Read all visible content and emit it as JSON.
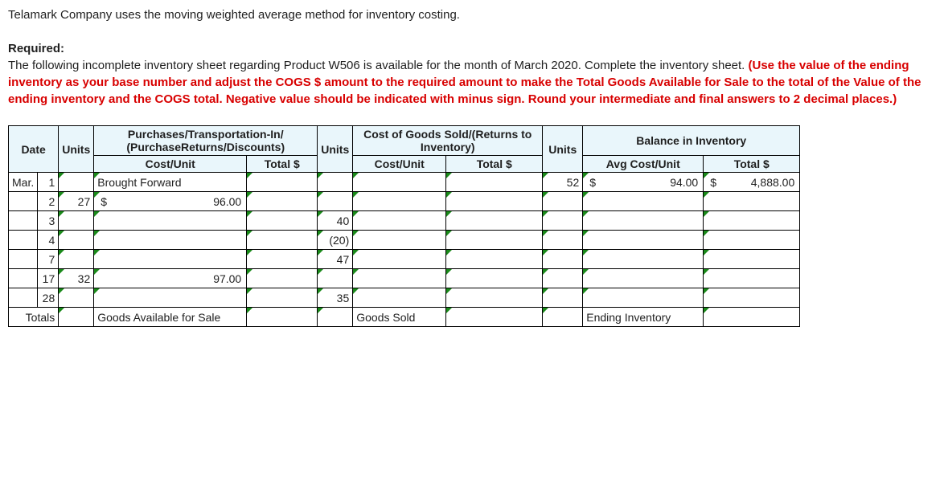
{
  "intro": {
    "line1": "Telamark Company uses the moving weighted average method for inventory costing.",
    "required_label": "Required:",
    "line2a": "The following incomplete inventory sheet regarding Product W506 is available for the month of March 2020. Complete the inventory sheet. ",
    "line2b": "(Use the value of the ending inventory as your base number and adjust the COGS $ amount to the required amount to make the Total Goods Available for Sale to the total of the Value of the ending inventory and the COGS total. Negative value should be indicated with minus sign. Round your intermediate and final answers to 2 decimal places.)"
  },
  "headers": {
    "date": "Date",
    "p_group": "Purchases/Transportation-In/ (PurchaseReturns/Discounts)",
    "c_group": "Cost of Goods Sold/(Returns to Inventory)",
    "b_group": "Balance in Inventory",
    "units": "Units",
    "cost_unit": "Cost/Unit",
    "avg_cost_unit": "Avg Cost/Unit",
    "total": "Total $"
  },
  "month": "Mar.",
  "rows": [
    {
      "day": "1",
      "p_units": "",
      "p_cu_text": "Brought Forward",
      "p_cu_val": "",
      "p_tot": "",
      "c_units": "",
      "c_cu": "",
      "c_tot": "",
      "b_units": "52",
      "b_cu_sym": "$",
      "b_cu_val": "94.00",
      "b_tot_sym": "$",
      "b_tot_val": "4,888.00"
    },
    {
      "day": "2",
      "p_units": "27",
      "p_cu_text": "",
      "p_cu_sym": "$",
      "p_cu_val": "96.00",
      "p_tot": "",
      "c_units": "",
      "c_cu": "",
      "c_tot": "",
      "b_units": "",
      "b_cu_sym": "",
      "b_cu_val": "",
      "b_tot_sym": "",
      "b_tot_val": ""
    },
    {
      "day": "3",
      "p_units": "",
      "p_cu_text": "",
      "p_cu_val": "",
      "p_tot": "",
      "c_units": "40",
      "c_cu": "",
      "c_tot": "",
      "b_units": "",
      "b_cu_sym": "",
      "b_cu_val": "",
      "b_tot_sym": "",
      "b_tot_val": ""
    },
    {
      "day": "4",
      "p_units": "",
      "p_cu_text": "",
      "p_cu_val": "",
      "p_tot": "",
      "c_units": "(20)",
      "c_cu": "",
      "c_tot": "",
      "b_units": "",
      "b_cu_sym": "",
      "b_cu_val": "",
      "b_tot_sym": "",
      "b_tot_val": ""
    },
    {
      "day": "7",
      "p_units": "",
      "p_cu_text": "",
      "p_cu_val": "",
      "p_tot": "",
      "c_units": "47",
      "c_cu": "",
      "c_tot": "",
      "b_units": "",
      "b_cu_sym": "",
      "b_cu_val": "",
      "b_tot_sym": "",
      "b_tot_val": ""
    },
    {
      "day": "17",
      "p_units": "32",
      "p_cu_text": "",
      "p_cu_val": "97.00",
      "p_tot": "",
      "c_units": "",
      "c_cu": "",
      "c_tot": "",
      "b_units": "",
      "b_cu_sym": "",
      "b_cu_val": "",
      "b_tot_sym": "",
      "b_tot_val": ""
    },
    {
      "day": "28",
      "p_units": "",
      "p_cu_text": "",
      "p_cu_val": "",
      "p_tot": "",
      "c_units": "35",
      "c_cu": "",
      "c_tot": "",
      "b_units": "",
      "b_cu_sym": "",
      "b_cu_val": "",
      "b_tot_sym": "",
      "b_tot_val": ""
    }
  ],
  "totals": {
    "label": "Totals",
    "p_label": "Goods Available for Sale",
    "c_label": "Goods Sold",
    "b_label": "Ending Inventory"
  }
}
